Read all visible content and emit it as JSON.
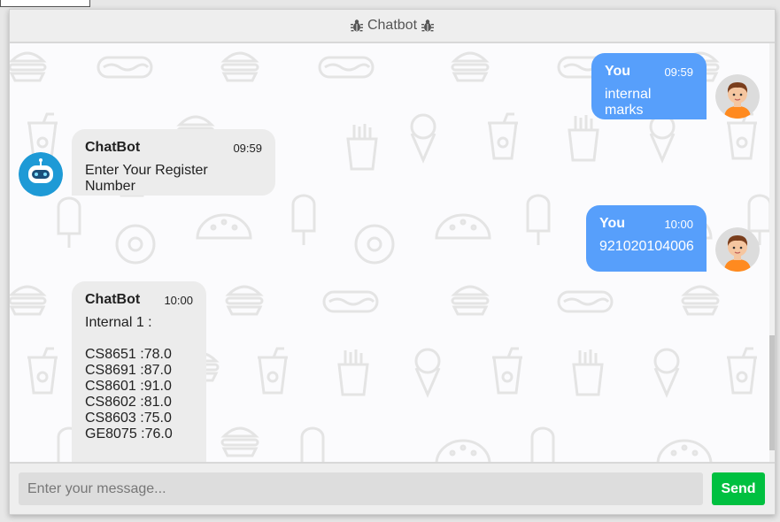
{
  "header": {
    "title": "Chatbot"
  },
  "messages": [
    {
      "side": "right",
      "name": "You",
      "time": "09:59",
      "text": "internal marks",
      "avatar": "user-avatar-icon"
    },
    {
      "side": "left",
      "name": "ChatBot",
      "time": "09:59",
      "text": "Enter Your Register Number",
      "avatar": "bot-avatar-icon"
    },
    {
      "side": "right",
      "name": "You",
      "time": "10:00",
      "text": "921020104006",
      "avatar": "user-avatar-icon"
    },
    {
      "side": "left",
      "name": "ChatBot",
      "time": "10:00",
      "text": "Internal 1 :\n\nCS8651 :78.0\nCS8691 :87.0\nCS8601 :91.0\nCS8602 :81.0\nCS8603 :75.0\nGE8075 :76.0",
      "avatar": "bot-avatar-icon"
    }
  ],
  "input": {
    "placeholder": "Enter your message...",
    "value": ""
  },
  "send": {
    "label": "Send"
  },
  "colors": {
    "user_bubble": "#579ffb",
    "bot_bubble": "#ececec",
    "send_button": "#00c040"
  }
}
